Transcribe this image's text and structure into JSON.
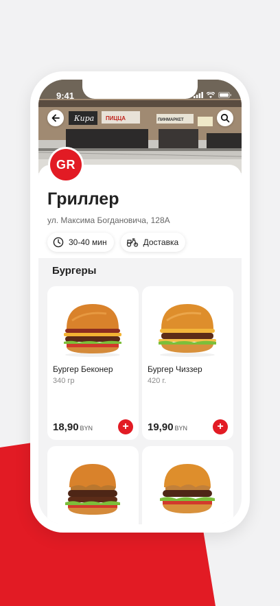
{
  "status_bar": {
    "time": "9:41"
  },
  "restaurant": {
    "logo_text": "GR",
    "name": "Гриллер",
    "address": "ул. Максима Богдановича, 128А",
    "delivery_time": "30-40 мин",
    "delivery_label": "Доставка",
    "hero_signs": [
      "Кира",
      "ПИЦЦА",
      "ПИНМАРКЕТ"
    ]
  },
  "menu": {
    "section_title": "Бургеры",
    "items": [
      {
        "name": "Бургер Беконер",
        "weight": "340 гр",
        "price": "18,90",
        "currency": "BYN"
      },
      {
        "name": "Бургер Чиззер",
        "weight": "420 г.",
        "price": "19,90",
        "currency": "BYN"
      },
      {
        "name": "",
        "weight": "",
        "price": "",
        "currency": ""
      },
      {
        "name": "",
        "weight": "",
        "price": "",
        "currency": ""
      }
    ]
  },
  "colors": {
    "accent": "#e21b24",
    "background": "#f2f2f3"
  },
  "icons": [
    "back-arrow-icon",
    "search-icon",
    "clock-icon",
    "scooter-icon",
    "plus-icon",
    "signal-icon",
    "wifi-icon",
    "battery-icon"
  ]
}
